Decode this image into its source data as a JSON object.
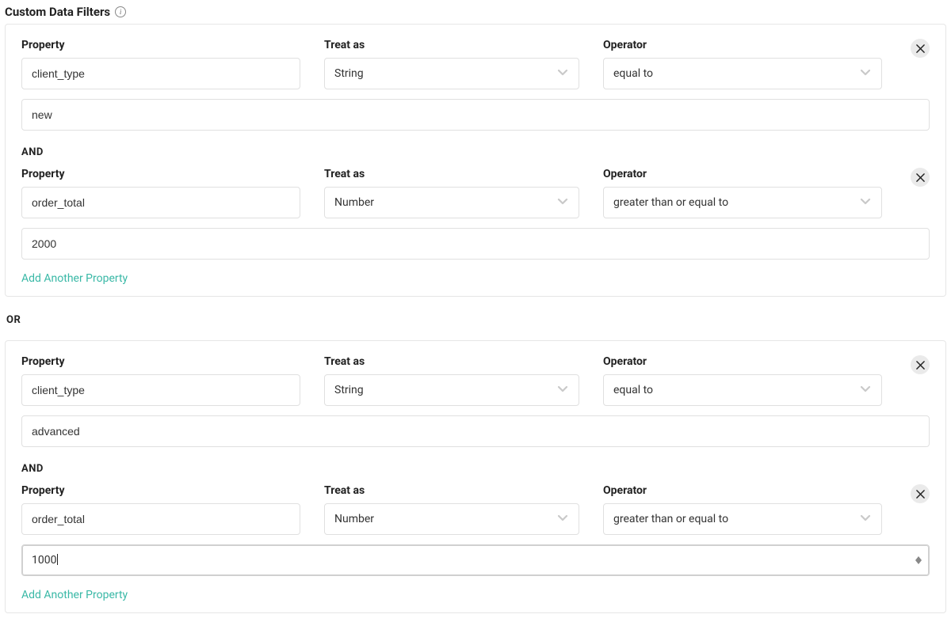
{
  "section_title": "Custom Data Filters",
  "labels": {
    "property": "Property",
    "treat_as": "Treat as",
    "operator": "Operator",
    "and": "AND",
    "or": "OR",
    "add_another": "Add Another Property"
  },
  "groups": [
    {
      "filters": [
        {
          "property": "client_type",
          "treat_as": "String",
          "operator": "equal to",
          "value": "new"
        },
        {
          "property": "order_total",
          "treat_as": "Number",
          "operator": "greater than or equal to",
          "value": "2000"
        }
      ]
    },
    {
      "filters": [
        {
          "property": "client_type",
          "treat_as": "String",
          "operator": "equal to",
          "value": "advanced"
        },
        {
          "property": "order_total",
          "treat_as": "Number",
          "operator": "greater than or equal to",
          "value": "1000"
        }
      ]
    }
  ]
}
